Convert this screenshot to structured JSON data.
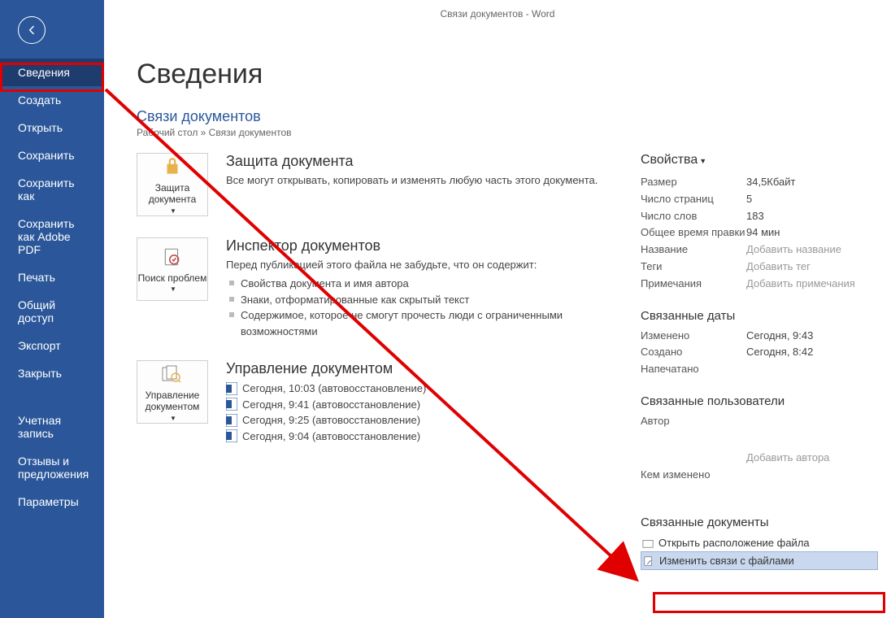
{
  "titlebar": "Связи документов   -   Word",
  "nav": {
    "items": [
      "Сведения",
      "Создать",
      "Открыть",
      "Сохранить",
      "Сохранить как",
      "Сохранить как Adobe PDF",
      "Печать",
      "Общий доступ",
      "Экспорт",
      "Закрыть",
      "Учетная запись",
      "Отзывы и предложения",
      "Параметры"
    ],
    "selected_index": 0
  },
  "page": {
    "title": "Сведения",
    "doclink": "Связи документов",
    "breadcrumb": "Рабочий стол » Связи документов"
  },
  "buttons": {
    "protect": "Защита документа",
    "inspect": "Поиск проблем",
    "manage": "Управление документом"
  },
  "sections": {
    "protect": {
      "head": "Защита документа",
      "desc": "Все могут открывать, копировать и изменять любую часть этого документа."
    },
    "inspect": {
      "head": "Инспектор документов",
      "desc": "Перед публикацией этого файла не забудьте, что он содержит:",
      "bullets": [
        "Свойства документа и имя автора",
        "Знаки, отформатированные как скрытый текст",
        "Содержимое, которое не смогут прочесть люди с ограниченными возможностями"
      ]
    },
    "manage": {
      "head": "Управление документом",
      "items": [
        "Сегодня, 10:03 (автовосстановление)",
        "Сегодня, 9:41 (автовосстановление)",
        "Сегодня, 9:25 (автовосстановление)",
        "Сегодня, 9:04 (автовосстановление)"
      ]
    }
  },
  "props": {
    "head": "Свойства",
    "rows": [
      {
        "k": "Размер",
        "v": "34,5Кбайт"
      },
      {
        "k": "Число страниц",
        "v": "5"
      },
      {
        "k": "Число слов",
        "v": "183"
      },
      {
        "k": "Общее время правки",
        "v": "94 мин"
      },
      {
        "k": "Название",
        "ph": "Добавить название"
      },
      {
        "k": "Теги",
        "ph": "Добавить тег"
      },
      {
        "k": "Примечания",
        "ph": "Добавить примечания"
      }
    ],
    "dates_head": "Связанные даты",
    "dates": [
      {
        "k": "Изменено",
        "v": "Сегодня, 9:43"
      },
      {
        "k": "Создано",
        "v": "Сегодня, 8:42"
      },
      {
        "k": "Напечатано",
        "v": ""
      }
    ],
    "users_head": "Связанные пользователи",
    "users": [
      {
        "k": "Автор",
        "ph": "Добавить автора",
        "blank_first": true
      },
      {
        "k": "Кем изменено",
        "v": ""
      }
    ],
    "docs_head": "Связанные документы",
    "open_location": "Открыть расположение файла",
    "edit_links": "Изменить связи с файлами"
  }
}
